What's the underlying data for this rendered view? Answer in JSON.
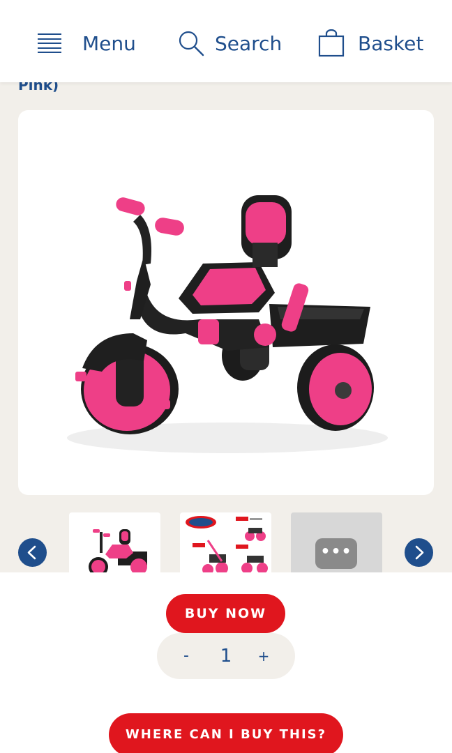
{
  "header": {
    "menu_label": "Menu",
    "search_label": "Search",
    "basket_label": "Basket",
    "menu_icon": "hamburger-icon",
    "search_icon": "magnifier-icon",
    "basket_icon": "shopping-bag-icon"
  },
  "product": {
    "title_fragment": "Pink)",
    "image_description_icon": "tricycle-product-image"
  },
  "gallery": {
    "more_label": "•••",
    "prev_icon": "chevron-left-icon",
    "next_icon": "chevron-right-icon"
  },
  "actions": {
    "buy_now_label": "BUY NOW",
    "quantity_minus": "-",
    "quantity_value": "1",
    "quantity_plus": "+",
    "where_to_buy_label": "WHERE CAN I BUY THIS?"
  },
  "colors": {
    "brand_blue": "#1f4e8c",
    "brand_red": "#e0161e",
    "page_bg": "#f2efea",
    "product_pink": "#ee3f87"
  }
}
